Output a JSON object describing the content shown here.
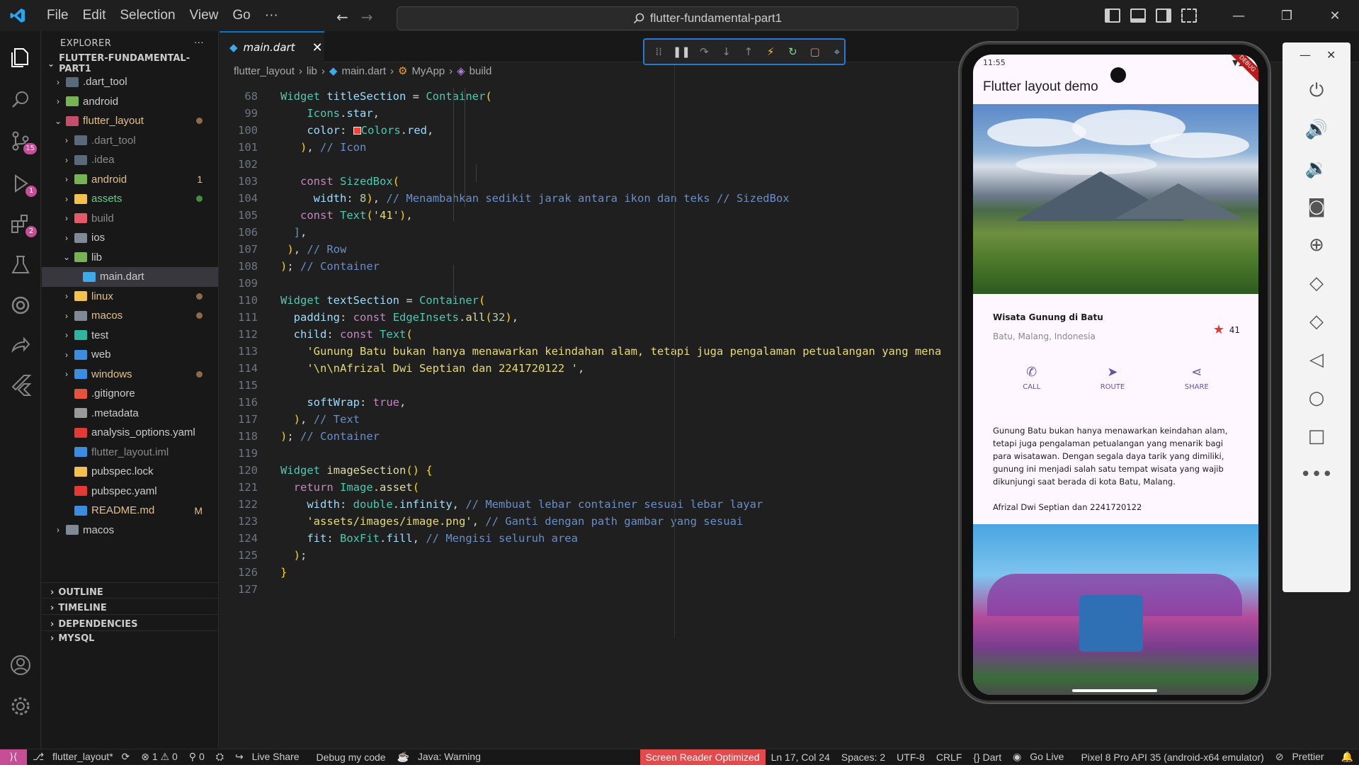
{
  "titlebar": {
    "menu": [
      "File",
      "Edit",
      "Selection",
      "View",
      "Go",
      "···"
    ],
    "search": "flutter-fundamental-part1"
  },
  "activity": {
    "scm_badge": "15",
    "debug_badge": "1",
    "ext_badge": "2"
  },
  "explorer": {
    "header": "EXPLORER",
    "more": "···",
    "root": "FLUTTER-FUNDAMENTAL-PART1",
    "items": [
      {
        "label": ".dart_tool",
        "indent": 1,
        "chev": "›",
        "color": "#cccccc",
        "icon": "#5a6a7a"
      },
      {
        "label": "android",
        "indent": 1,
        "chev": "›",
        "color": "#cccccc",
        "icon": "#77b255"
      },
      {
        "label": "flutter_layout",
        "indent": 1,
        "chev": "⌄",
        "color": "#e2c08d",
        "icon": "#c54e6e",
        "dot": "#8c6b4a"
      },
      {
        "label": ".dart_tool",
        "indent": 2,
        "chev": "›",
        "color": "#8b8b8b",
        "icon": "#5a6a7a"
      },
      {
        "label": ".idea",
        "indent": 2,
        "chev": "›",
        "color": "#8b8b8b",
        "icon": "#5a6a7a"
      },
      {
        "label": "android",
        "indent": 2,
        "chev": "›",
        "color": "#e2c08d",
        "icon": "#77b255",
        "deco": "1"
      },
      {
        "label": "assets",
        "indent": 2,
        "chev": "›",
        "color": "#73c991",
        "icon": "#f2c14e",
        "dot": "#3f8f3f"
      },
      {
        "label": "build",
        "indent": 2,
        "chev": "›",
        "color": "#8b8b8b",
        "icon": "#e35a6b"
      },
      {
        "label": "ios",
        "indent": 2,
        "chev": "›",
        "color": "#cccccc",
        "icon": "#7f8a96"
      },
      {
        "label": "lib",
        "indent": 2,
        "chev": "⌄",
        "color": "#cccccc",
        "icon": "#77b255"
      },
      {
        "label": "main.dart",
        "indent": 3,
        "chev": "",
        "color": "#cccccc",
        "icon": "#40a9e8",
        "selected": true
      },
      {
        "label": "linux",
        "indent": 2,
        "chev": "›",
        "color": "#e2c08d",
        "icon": "#f2c14e",
        "dot": "#8c6b4a"
      },
      {
        "label": "macos",
        "indent": 2,
        "chev": "›",
        "color": "#e2c08d",
        "icon": "#7f8a96",
        "dot": "#8c6b4a"
      },
      {
        "label": "test",
        "indent": 2,
        "chev": "›",
        "color": "#cccccc",
        "icon": "#2fb6a1"
      },
      {
        "label": "web",
        "indent": 2,
        "chev": "›",
        "color": "#cccccc",
        "icon": "#3b8de0"
      },
      {
        "label": "windows",
        "indent": 2,
        "chev": "›",
        "color": "#e2c08d",
        "icon": "#3b8de0",
        "dot": "#8c6b4a"
      },
      {
        "label": ".gitignore",
        "indent": 2,
        "chev": "",
        "color": "#cccccc",
        "icon": "#e5533d"
      },
      {
        "label": ".metadata",
        "indent": 2,
        "chev": "",
        "color": "#cccccc",
        "icon": "#9a9a9a"
      },
      {
        "label": "analysis_options.yaml",
        "indent": 2,
        "chev": "",
        "color": "#cccccc",
        "icon": "#e53935"
      },
      {
        "label": "flutter_layout.iml",
        "indent": 2,
        "chev": "",
        "color": "#8b8b8b",
        "icon": "#3b8de0"
      },
      {
        "label": "pubspec.lock",
        "indent": 2,
        "chev": "",
        "color": "#cccccc",
        "icon": "#f2c14e"
      },
      {
        "label": "pubspec.yaml",
        "indent": 2,
        "chev": "",
        "color": "#cccccc",
        "icon": "#e53935"
      },
      {
        "label": "README.md",
        "indent": 2,
        "chev": "",
        "color": "#e2c08d",
        "icon": "#3b8de0",
        "deco": "M"
      },
      {
        "label": "macos",
        "indent": 1,
        "chev": "›",
        "color": "#cccccc",
        "icon": "#7f8a96"
      }
    ],
    "sections": [
      "OUTLINE",
      "TIMELINE",
      "DEPENDENCIES",
      "MYSQL"
    ]
  },
  "editor": {
    "tab": "main.dart",
    "breadcrumb": [
      "flutter_layout",
      "lib",
      "main.dart",
      "MyApp",
      "build"
    ],
    "lines": [
      {
        "n": "68",
        "h": "<span class='ty'>Widget</span> <span class='v'>titleSection</span> = <span class='ty'>Container</span><span class='p'>(</span>"
      },
      {
        "n": "99",
        "h": "    <span class='ty'>Icons</span>.<span class='v'>star</span>,"
      },
      {
        "n": "100",
        "h": "    <span class='v'>color</span>: <span style='display:inline-block;width:11px;height:11px;background:#f44336;border:1px solid #fff;vertical-align:middle'></span><span class='ty'>Colors</span>.<span class='v'>red</span>,"
      },
      {
        "n": "101",
        "h": "   <span class='p'>)</span>, <span class='cm'>// Icon</span>"
      },
      {
        "n": "102",
        "h": ""
      },
      {
        "n": "103",
        "h": "   <span class='k'>const</span> <span class='ty'>SizedBox</span><span class='p'>(</span>"
      },
      {
        "n": "104",
        "h": "     <span class='v'>width</span>: <span class='n'>8</span><span class='p'>)</span>, <span class='cm'>// Menambahkan sedikit jarak antara ikon dan teks // SizedBox</span>"
      },
      {
        "n": "105",
        "h": "   <span class='k'>const</span> <span class='ty'>Text</span><span class='p'>(</span><span class='str'>'41'</span><span class='p'>)</span>,"
      },
      {
        "n": "106",
        "h": "  <span class='bl'>]</span>,"
      },
      {
        "n": "107",
        "h": " <span class='p'>)</span>, <span class='cm'>// Row</span>"
      },
      {
        "n": "108",
        "h": "<span class='p'>)</span>; <span class='cm'>// Container</span>"
      },
      {
        "n": "109",
        "h": ""
      },
      {
        "n": "110",
        "h": "<span class='ty'>Widget</span> <span class='v'>textSection</span> = <span class='ty'>Container</span><span class='p'>(</span>"
      },
      {
        "n": "111",
        "h": "  <span class='v'>padding</span>: <span class='k'>const</span> <span class='ty'>EdgeInsets</span>.<span class='f'>all</span><span class='p'>(</span><span class='n'>32</span><span class='p'>)</span>,"
      },
      {
        "n": "112",
        "h": "  <span class='v'>child</span>: <span class='k'>const</span> <span class='ty'>Text</span><span class='p'>(</span>"
      },
      {
        "n": "113",
        "h": "    <span class='str'>'Gunung Batu bukan hanya menawarkan keindahan alam, tetapi juga pengalaman petualangan yang mena</span>"
      },
      {
        "n": "114",
        "h": "    <span class='str'>'\\n\\nAfrizal Dwi Septian dan 2241720122 '</span>,"
      },
      {
        "n": "115",
        "h": ""
      },
      {
        "n": "116",
        "h": "    <span class='v'>softWrap</span>: <span class='k'>true</span>,"
      },
      {
        "n": "117",
        "h": "  <span class='p'>)</span>, <span class='cm'>// Text</span>"
      },
      {
        "n": "118",
        "h": "<span class='p'>)</span>; <span class='cm'>// Container</span>"
      },
      {
        "n": "119",
        "h": ""
      },
      {
        "n": "120",
        "h": "<span class='ty'>Widget</span> <span class='f'>imageSection</span><span class='p'>()</span> <span class='p'>{</span>"
      },
      {
        "n": "121",
        "h": "  <span class='k'>return</span> <span class='ty'>Image</span>.<span class='f'>asset</span><span class='p'>(</span>"
      },
      {
        "n": "122",
        "h": "    <span class='v'>width</span>: <span class='ty'>double</span>.<span class='v'>infinity</span>, <span class='cm'>// Membuat lebar container sesuai lebar layar</span>"
      },
      {
        "n": "123",
        "h": "    <span class='str'>'assets/images/image.png'</span>, <span class='cm'>// Ganti dengan path gambar yang sesuai</span>"
      },
      {
        "n": "124",
        "h": "    <span class='v'>fit</span>: <span class='ty'>BoxFit</span>.<span class='v'>fill</span>, <span class='cm'>// Mengisi seluruh area</span>"
      },
      {
        "n": "125",
        "h": "  <span class='p'>)</span>;"
      },
      {
        "n": "126",
        "h": "<span class='p'>}</span>"
      },
      {
        "n": "127",
        "h": ""
      }
    ]
  },
  "phone": {
    "time": "11:55",
    "appbar": "Flutter layout demo",
    "debug": "DEBUG",
    "title": "Wisata Gunung di Batu",
    "subtitle": "Batu, Malang, Indonesia",
    "star_count": "41",
    "buttons": [
      "CALL",
      "ROUTE",
      "SHARE"
    ],
    "paragraph": "Gunung Batu bukan hanya menawarkan keindahan alam, tetapi juga pengalaman petualangan yang menarik bagi para wisatawan. Dengan segala daya tarik yang dimiliki, gunung ini menjadi salah satu tempat wisata yang wajib dikunjungi saat berada di kota Batu, Malang.",
    "author": "Afrizal Dwi Septian dan 2241720122"
  },
  "status": {
    "branch": "flutter_layout*",
    "problems": "⊗ 1 ⚠ 0",
    "ports": "⚲ 0",
    "liveshare": "Live Share",
    "debugcode": "Debug my code",
    "java": "Java: Warning",
    "sro": "Screen Reader Optimized",
    "pos": "Ln 17, Col 24",
    "spaces": "Spaces: 2",
    "enc": "UTF-8",
    "eol": "CRLF",
    "lang": "{} Dart",
    "golive": "Go Live",
    "device": "Pixel 8 Pro API 35 (android-x64 emulator)",
    "prettier": "Prettier"
  }
}
